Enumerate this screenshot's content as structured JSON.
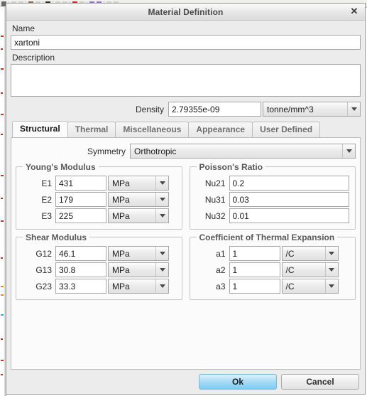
{
  "window": {
    "title": "Material Definition",
    "close_icon": "close-icon",
    "close_glyph": "✕"
  },
  "form": {
    "name_label": "Name",
    "name_value": "xartoni",
    "description_label": "Description",
    "description_value": "",
    "density_label": "Density",
    "density_value": "2.79355e-09",
    "density_unit": "tonne/mm^3"
  },
  "tabs": [
    {
      "label": "Structural",
      "active": true
    },
    {
      "label": "Thermal",
      "active": false
    },
    {
      "label": "Miscellaneous",
      "active": false
    },
    {
      "label": "Appearance",
      "active": false
    },
    {
      "label": "User Defined",
      "active": false
    }
  ],
  "structural": {
    "symmetry_label": "Symmetry",
    "symmetry_value": "Orthotropic",
    "youngs_modulus": {
      "title": "Young's Modulus",
      "rows": [
        {
          "label": "E1",
          "value": "431",
          "unit": "MPa"
        },
        {
          "label": "E2",
          "value": "179",
          "unit": "MPa"
        },
        {
          "label": "E3",
          "value": "225",
          "unit": "MPa"
        }
      ]
    },
    "poissons_ratio": {
      "title": "Poisson's Ratio",
      "rows": [
        {
          "label": "Nu21",
          "value": "0.2"
        },
        {
          "label": "Nu31",
          "value": "0.03"
        },
        {
          "label": "Nu32",
          "value": "0.01"
        }
      ]
    },
    "shear_modulus": {
      "title": "Shear Modulus",
      "rows": [
        {
          "label": "G12",
          "value": "46.1",
          "unit": "MPa"
        },
        {
          "label": "G13",
          "value": "30.8",
          "unit": "MPa"
        },
        {
          "label": "G23",
          "value": "33.3",
          "unit": "MPa"
        }
      ]
    },
    "thermal_expansion": {
      "title": "Coefficient of Thermal Expansion",
      "rows": [
        {
          "label": "a1",
          "value": "1",
          "unit": "/C"
        },
        {
          "label": "a2",
          "value": "1",
          "unit": "/C"
        },
        {
          "label": "a3",
          "value": "1",
          "unit": "/C"
        }
      ]
    }
  },
  "buttons": {
    "ok": "Ok",
    "cancel": "Cancel"
  },
  "colors": {
    "accent": "#a9dcf5",
    "dialog_bg": "#ececed",
    "panel_bg": "#fbfbfb",
    "title_text": "#4a4a4a"
  }
}
